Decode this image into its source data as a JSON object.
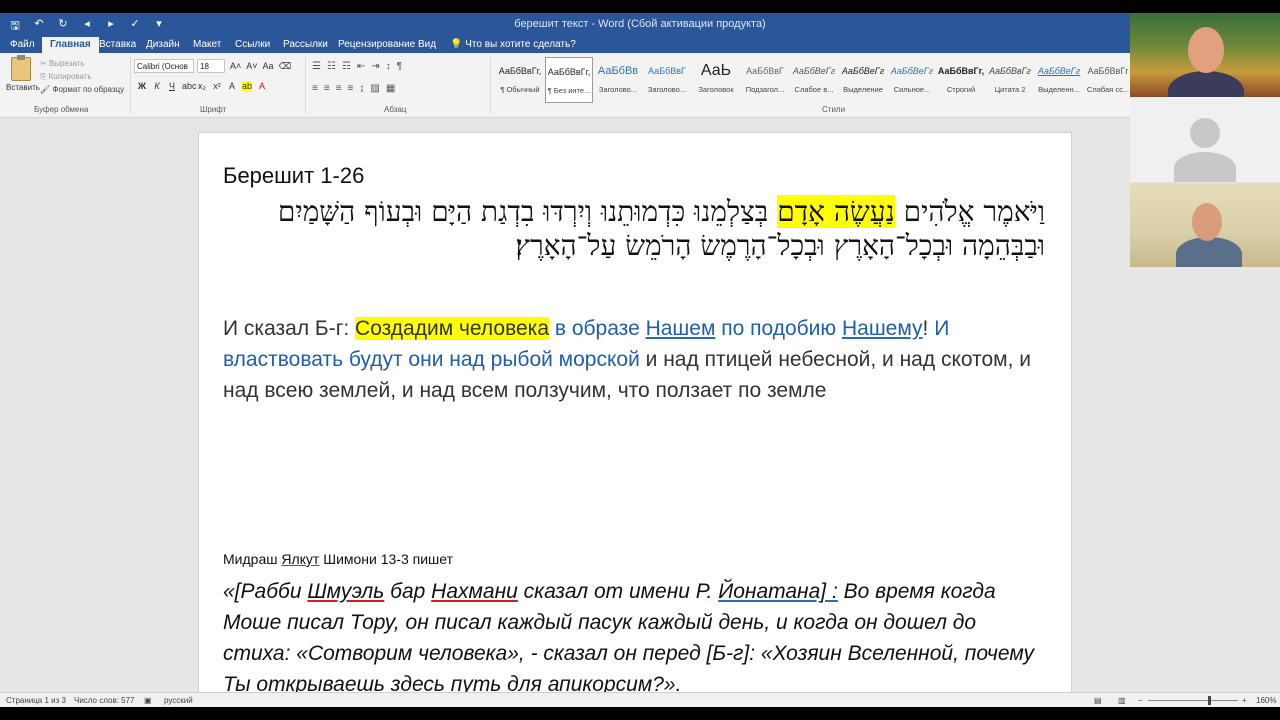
{
  "window": {
    "title": "берешит текст - Word (Сбой активации продукта)"
  },
  "qat_icons": [
    "save-icon",
    "undo-icon",
    "redo-icon",
    "prev-icon",
    "next-icon",
    "spellcheck-icon",
    "customize-icon"
  ],
  "tabs": [
    {
      "label": "Файл",
      "active": false
    },
    {
      "label": "Главная",
      "active": true
    },
    {
      "label": "Вставка",
      "active": false
    },
    {
      "label": "Дизайн",
      "active": false
    },
    {
      "label": "Макет",
      "active": false
    },
    {
      "label": "Ссылки",
      "active": false
    },
    {
      "label": "Рассылки",
      "active": false
    },
    {
      "label": "Рецензирование",
      "active": false
    },
    {
      "label": "Вид",
      "active": false
    }
  ],
  "tell_me": "Что вы хотите сделать?",
  "ribbon": {
    "clipboard": {
      "paste": "Вставить",
      "cut": "Вырезать",
      "copy": "Копировать",
      "format_painter": "Формат по образцу",
      "group": "Буфер обмена"
    },
    "font": {
      "name": "Calibri (Основ",
      "size": "18",
      "group": "Шрифт"
    },
    "paragraph": {
      "group": "Абзац"
    },
    "styles": {
      "group": "Стили",
      "items": [
        {
          "sample": "АаБбВвГг,",
          "name": "¶ Обычный",
          "selected": false
        },
        {
          "sample": "АаБбВвГг,",
          "name": "¶ Без инте...",
          "selected": true
        },
        {
          "sample": "АаБбВв",
          "name": "Заголово...",
          "selected": false
        },
        {
          "sample": "АаБбВвГ",
          "name": "Заголово...",
          "selected": false
        },
        {
          "sample": "АаЬ",
          "name": "Заголовок",
          "selected": false
        },
        {
          "sample": "АаБбВвГ",
          "name": "Подзагол...",
          "selected": false
        },
        {
          "sample": "АаБбВеГг",
          "name": "Слабое в...",
          "selected": false
        },
        {
          "sample": "АаБбВеГг",
          "name": "Выделение",
          "selected": false
        },
        {
          "sample": "АаБбВеГг",
          "name": "Сильное...",
          "selected": false
        },
        {
          "sample": "АаБбВвГг,",
          "name": "Строгий",
          "selected": false
        },
        {
          "sample": "АаБбВвГг",
          "name": "Цитата 2",
          "selected": false
        },
        {
          "sample": "АаБбВеГг",
          "name": "Выделенн...",
          "selected": false
        },
        {
          "sample": "АаБбВвГг",
          "name": "Слабая сс...",
          "selected": false
        }
      ]
    }
  },
  "document": {
    "ref": "Берешит 1-26",
    "hebrew": {
      "part1": "וַיֹּאמֶר אֱלֹהִים ",
      "highlight": "נַעֲשֶׂה אָדָם",
      "part2": " בְּצַלְמֵנוּ כִּדְמוּתֵנוּ וְיִרְדּוּ בִדְגַת הַיָּם וּבְעוֹף הַשָּׁמַיִם וּבַבְּהֵמָה וּבְכָל־הָאָרֶץ וּבְכָל־הָרֶמֶשׂ הָרֹמֵשׂ עַל־הָאָרֶץ׃"
    },
    "russian": {
      "p1": "И сказал Б-г: ",
      "highlight": "Создадим человека",
      "p2": " в образе ",
      "p3": "Нашем",
      "p4": " по подобию ",
      "p5": "Нашему",
      "p6": "! ",
      "p7": "И властвовать будут они над рыбой морской",
      "p8": " и над птицей небесной, и над скотом, и над всею землей, и над всем ползучим, что ползает по земле"
    },
    "midrash": {
      "a": "Мидраш ",
      "b": "Ялкут",
      "c": " Шимони 13-3 пишет"
    },
    "quote": {
      "a": "«[Рабби ",
      "b": "Шмуэль",
      "c": " бар ",
      "d": "Нахмани",
      "e": " сказал от имени Р. ",
      "f": "Йонатана] :",
      "g": " Во время когда Моше писал Тору, он писал каждый пасук каждый день, и когда он дошел до стиха: «Сотворим человека», - сказал он перед [Б-г]: «Хозяин Вселенной, почему Ты открываешь здесь путь для апикорсим?»."
    }
  },
  "status": {
    "page": "Страница 1 из 3",
    "words": "Число слов: 577",
    "lang": "русский",
    "zoom": "160%"
  },
  "video": {
    "participants": 3
  }
}
